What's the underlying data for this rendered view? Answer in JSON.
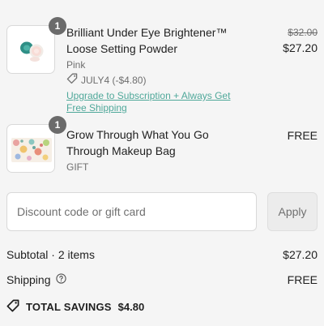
{
  "items": [
    {
      "quantity": "1",
      "title": "Brilliant Under Eye Brightener™ Loose Setting Powder",
      "variant": "Pink",
      "discount_code": "JULY4 (-$4.80)",
      "upgrade_link": "Upgrade to Subscription + Always Get Free Shipping",
      "original_price": "$32.00",
      "price": "$27.20",
      "thumb_icon": "compact-powder-icon"
    },
    {
      "quantity": "1",
      "title": "Grow Through What You Go Through Makeup Bag",
      "variant": "GIFT",
      "price": "FREE",
      "thumb_icon": "floral-makeup-bag-icon"
    }
  ],
  "discount": {
    "placeholder": "Discount code or gift card",
    "apply_label": "Apply"
  },
  "summary": {
    "subtotal_label": "Subtotal · 2 items",
    "subtotal_value": "$27.20",
    "shipping_label": "Shipping",
    "shipping_value": "FREE",
    "savings_label": "TOTAL SAVINGS",
    "savings_value": "$4.80"
  },
  "colors": {
    "link": "#4fa89a",
    "badge": "#6b6b6b",
    "background": "#f5f5f5"
  }
}
